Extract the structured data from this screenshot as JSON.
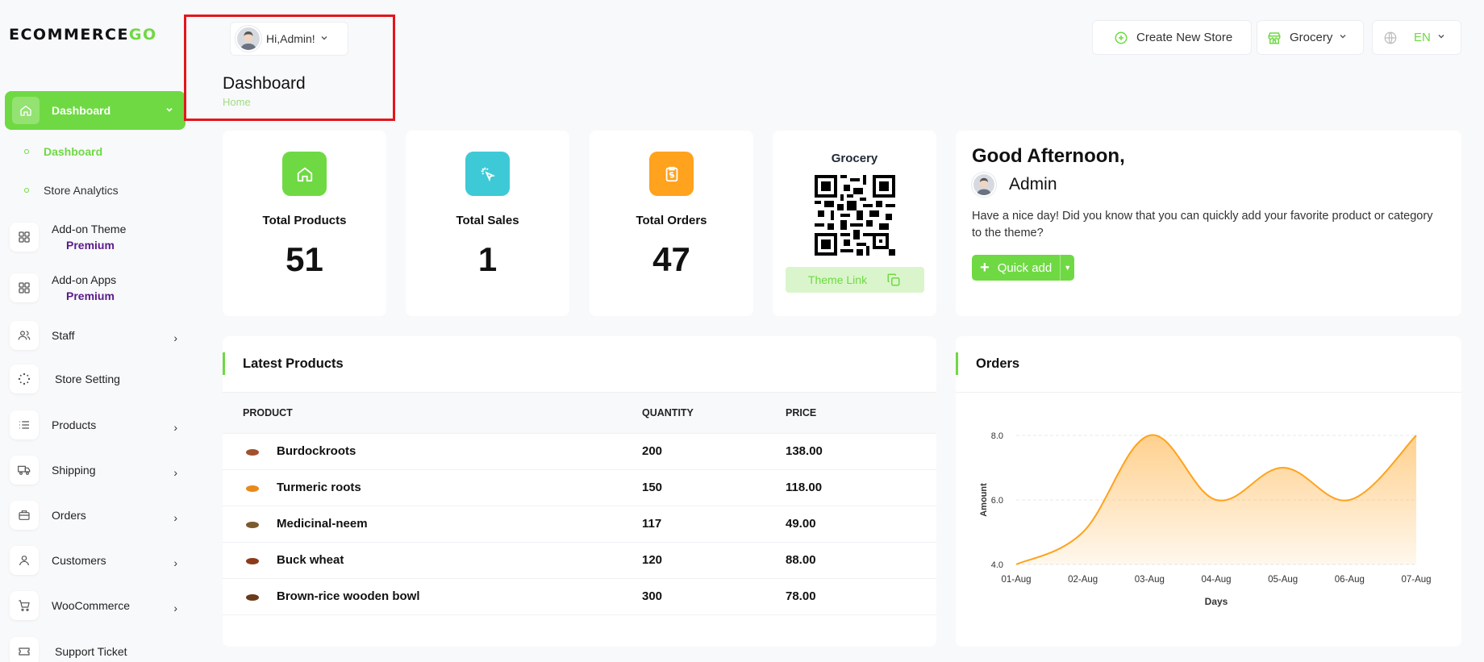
{
  "brand": {
    "logo_main": "ECOMMERCE",
    "logo_accent": "GO"
  },
  "sidebar": {
    "active": {
      "label": "Dashboard"
    },
    "sub": [
      {
        "label": "Dashboard"
      },
      {
        "label": "Store Analytics"
      }
    ],
    "items": [
      {
        "label": "Add-on Theme",
        "badge": "Premium"
      },
      {
        "label": "Add-on Apps",
        "badge": "Premium"
      },
      {
        "label": "Staff"
      },
      {
        "label": "Store Setting"
      },
      {
        "label": "Products"
      },
      {
        "label": "Shipping"
      },
      {
        "label": "Orders"
      },
      {
        "label": "Customers"
      },
      {
        "label": "WooCommerce"
      },
      {
        "label": "Support Ticket"
      }
    ]
  },
  "header": {
    "user_greeting": "Hi,Admin!",
    "page_title": "Dashboard",
    "breadcrumb": "Home",
    "create_store": "Create New Store",
    "store_select": "Grocery",
    "language": "EN"
  },
  "stats": [
    {
      "label": "Total Products",
      "value": "51",
      "color": "#6fd943"
    },
    {
      "label": "Total Sales",
      "value": "1",
      "color": "#3ec9d6"
    },
    {
      "label": "Total Orders",
      "value": "47",
      "color": "#ffa21d"
    }
  ],
  "qr": {
    "title": "Grocery",
    "link_label": "Theme Link"
  },
  "greeting": {
    "title": "Good Afternoon,",
    "name": "Admin",
    "message": "Have a nice day! Did you know that you can quickly add your favorite product or category to the theme?",
    "quick_add": "Quick add"
  },
  "latest_products": {
    "title": "Latest Products",
    "columns": [
      "PRODUCT",
      "QUANTITY",
      "PRICE"
    ],
    "rows": [
      {
        "name": "Burdockroots",
        "qty": "200",
        "price": "138.00",
        "thumb": "#a0522d"
      },
      {
        "name": "Turmeric roots",
        "qty": "150",
        "price": "118.00",
        "thumb": "#e8891c"
      },
      {
        "name": "Medicinal-neem",
        "qty": "117",
        "price": "49.00",
        "thumb": "#7a5a2f"
      },
      {
        "name": "Buck wheat",
        "qty": "120",
        "price": "88.00",
        "thumb": "#8b3a1a"
      },
      {
        "name": "Brown-rice wooden bowl",
        "qty": "300",
        "price": "78.00",
        "thumb": "#6b3a1a"
      }
    ]
  },
  "orders_card": {
    "title": "Orders"
  },
  "chart_data": {
    "type": "area",
    "x": [
      "01-Aug",
      "02-Aug",
      "03-Aug",
      "04-Aug",
      "05-Aug",
      "06-Aug",
      "07-Aug"
    ],
    "series": [
      {
        "values": [
          4,
          5,
          8,
          6,
          7,
          6,
          8
        ]
      }
    ],
    "ylabel": "Amount",
    "xlabel": "Days",
    "yticks": [
      "4.0",
      "6.0",
      "8.0"
    ],
    "ylim": [
      4,
      8
    ],
    "color": "#ffa21d"
  }
}
